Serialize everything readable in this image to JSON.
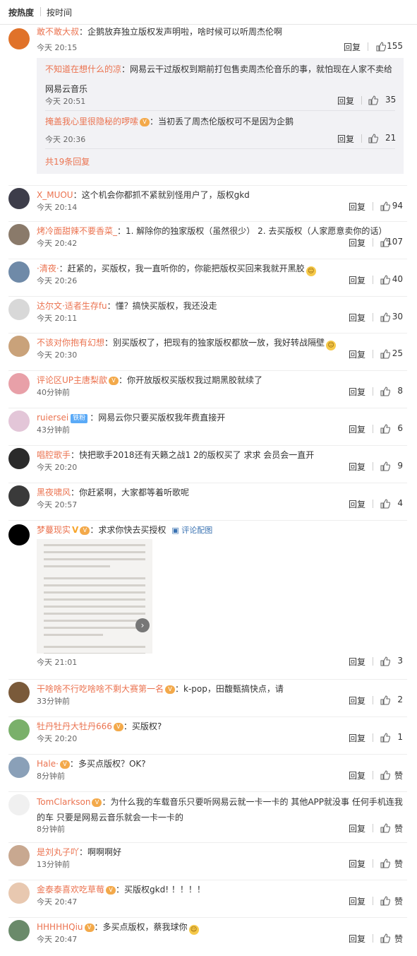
{
  "sort": {
    "hot": "按热度",
    "time": "按时间"
  },
  "reply_label": "回复",
  "like_label": "赞",
  "comments": [
    {
      "user": "敢不敢大叔",
      "text": "企鹅放弃独立版权发声明啦，啥时候可以听周杰伦啊",
      "time": "今天 20:15",
      "likes": "155",
      "replies": [
        {
          "user": "不知道在想什么的凉",
          "text": "网易云干过版权到期前打包售卖周杰伦音乐的事，就怕现在人家不卖给网易云音乐",
          "time": "今天 20:51",
          "likes": "35"
        },
        {
          "user": "掩盖我心里很隐秘的啰嗦",
          "text": "当初丢了周杰伦版权可不是因为企鹅",
          "time": "今天 20:36",
          "likes": "21"
        }
      ],
      "more": "共19条回复"
    },
    {
      "user": "X_MUOU",
      "text": "这个机会你都抓不紧就别怪用户了，版权gkd",
      "time": "今天 20:14",
      "likes": "94"
    },
    {
      "user": "烤冷面甜辣不要香菜_",
      "text": "1. 解除你的独家版权（虽然很少） 2. 去买版权（人家愿意卖你的话）",
      "time": "今天 20:42",
      "likes": "107"
    },
    {
      "user": "·清夜·",
      "text": "赶紧的，买版权，我一直听你的，你能把版权买回来我就开黑胶",
      "time": "今天 20:26",
      "likes": "40"
    },
    {
      "user": "达尔文·适者生存fu",
      "text": "懂？搞快买版权，我还没走",
      "time": "今天 20:11",
      "likes": "30"
    },
    {
      "user": "不该对你抱有幻想",
      "text": "别买版权了，把现有的独家版权都放一放，我好转战隔壁",
      "time": "今天 20:30",
      "likes": "25"
    },
    {
      "user": "评论区UP主唐梨歆",
      "text": "你开放版权买版权我过期黑胶就续了",
      "time": "40分钟前",
      "likes": "8"
    },
    {
      "user": "ruiersei",
      "fan": "铁粉",
      "text": "网易云你只要买版权我年费直接开",
      "time": "43分钟前",
      "likes": "6"
    },
    {
      "user": "唱腔歌手",
      "text": "快把歌手2018还有天籁之战1 2的版权买了 求求 会员会一直开",
      "time": "今天 20:20",
      "likes": "9"
    },
    {
      "user": "黑夜啸风",
      "text": "你赶紧啊，大家都等着听歌呢",
      "time": "今天 20:57",
      "likes": "4"
    },
    {
      "user": "梦蔓现实",
      "text": "求求你快去买授权",
      "img_link": "评论配图",
      "time": "今天 21:01",
      "likes": "3"
    },
    {
      "user": "干啥啥不行吃啥啥不剩大赛第一名",
      "text": "k-pop，田馥甄搞快点，请",
      "time": "33分钟前",
      "likes": "2"
    },
    {
      "user": "牡丹牡丹大牡丹666",
      "text": "买版权?",
      "time": "今天 20:20",
      "likes": "1"
    },
    {
      "user": "Hale·",
      "text": "多买点版权？OK?",
      "time": "8分钟前",
      "likes": ""
    },
    {
      "user": "TomClarkson",
      "text": "为什么我的车载音乐只要听网易云就一卡一卡的 其他APP就没事 任何手机连我的车 只要是网易云音乐就会一卡一卡的",
      "time": "8分钟前",
      "likes": ""
    },
    {
      "user": "是刘丸子吖",
      "text": "啊啊啊好",
      "time": "13分钟前",
      "likes": ""
    },
    {
      "user": "金泰泰喜欢吃草莓",
      "text": "买版权gkd! ！！！！",
      "time": "今天 20:47",
      "likes": ""
    },
    {
      "user": "HHHHHQiu",
      "text": "多买点版权，蔡我球你",
      "time": "今天 20:47",
      "likes": ""
    }
  ],
  "colors": {
    "username": "#eb7350",
    "link": "#3a72b2",
    "sub_bg": "#f2f2f5"
  }
}
